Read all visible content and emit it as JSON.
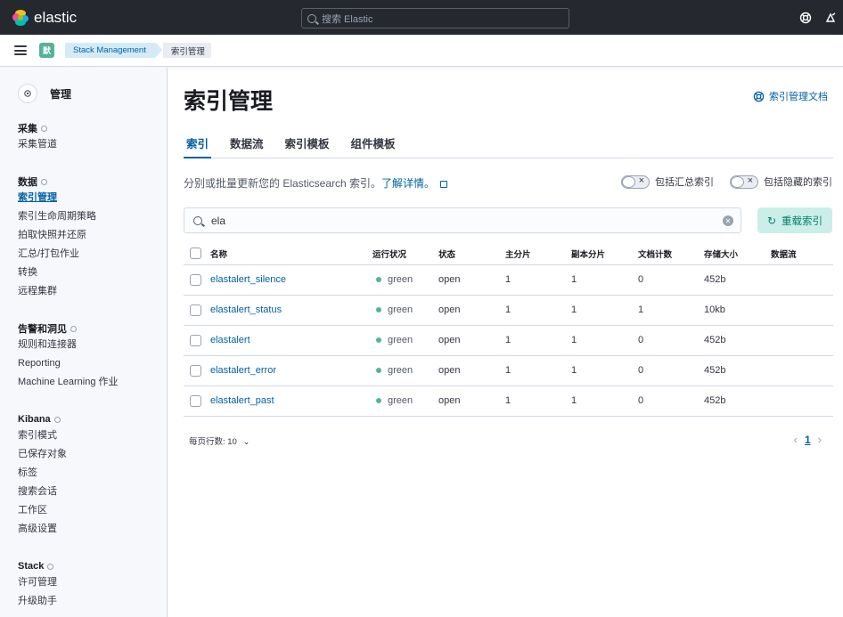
{
  "header": {
    "brand": "elastic",
    "search_placeholder": "搜索 Elastic"
  },
  "breadcrumbs": {
    "space_initial": "默",
    "items": [
      "Stack Management",
      "索引管理"
    ]
  },
  "sidebar": {
    "title": "管理",
    "groups": [
      {
        "title": "采集",
        "items": [
          "采集管道"
        ]
      },
      {
        "title": "数据",
        "items": [
          "索引管理",
          "索引生命周期策略",
          "拍取快照并还原",
          "汇总/打包作业",
          "转换",
          "远程集群"
        ]
      },
      {
        "title": "告警和洞见",
        "items": [
          "规则和连接器",
          "Reporting",
          "Machine Learning 作业"
        ]
      },
      {
        "title": "Kibana",
        "items": [
          "索引模式",
          "已保存对象",
          "标签",
          "搜索会话",
          "工作区",
          "高级设置"
        ]
      },
      {
        "title": "Stack",
        "items": [
          "许可管理",
          "升级助手"
        ]
      }
    ],
    "active_item": "索引管理"
  },
  "main": {
    "title": "索引管理",
    "doc_link": "索引管理文档",
    "tabs": [
      "索引",
      "数据流",
      "索引模板",
      "组件模板"
    ],
    "active_tab": "索引",
    "description": "分别或批量更新您的 Elasticsearch 索引。",
    "learn_more": "了解详情。",
    "toggle_rollup": "包括汇总索引",
    "toggle_hidden": "包括隐藏的索引",
    "search_value": "ela",
    "reload_button": "重载索引",
    "columns": [
      "名称",
      "运行状况",
      "状态",
      "主分片",
      "副本分片",
      "文档计数",
      "存储大小",
      "数据流"
    ],
    "rows": [
      {
        "name": "elastalert_silence",
        "health": "green",
        "status": "open",
        "primary": "1",
        "replica": "1",
        "docs": "0",
        "size": "452b",
        "stream": ""
      },
      {
        "name": "elastalert_status",
        "health": "green",
        "status": "open",
        "primary": "1",
        "replica": "1",
        "docs": "1",
        "size": "10kb",
        "stream": ""
      },
      {
        "name": "elastalert",
        "health": "green",
        "status": "open",
        "primary": "1",
        "replica": "1",
        "docs": "0",
        "size": "452b",
        "stream": ""
      },
      {
        "name": "elastalert_error",
        "health": "green",
        "status": "open",
        "primary": "1",
        "replica": "1",
        "docs": "0",
        "size": "452b",
        "stream": ""
      },
      {
        "name": "elastalert_past",
        "health": "green",
        "status": "open",
        "primary": "1",
        "replica": "1",
        "docs": "0",
        "size": "452b",
        "stream": ""
      }
    ],
    "rows_per_page": "每页行数: 10",
    "current_page": "1"
  },
  "colors": {
    "header_bg": "#25282f",
    "link": "#0061a6",
    "health_green": "#54b399",
    "reload_bg": "#cceee8"
  }
}
